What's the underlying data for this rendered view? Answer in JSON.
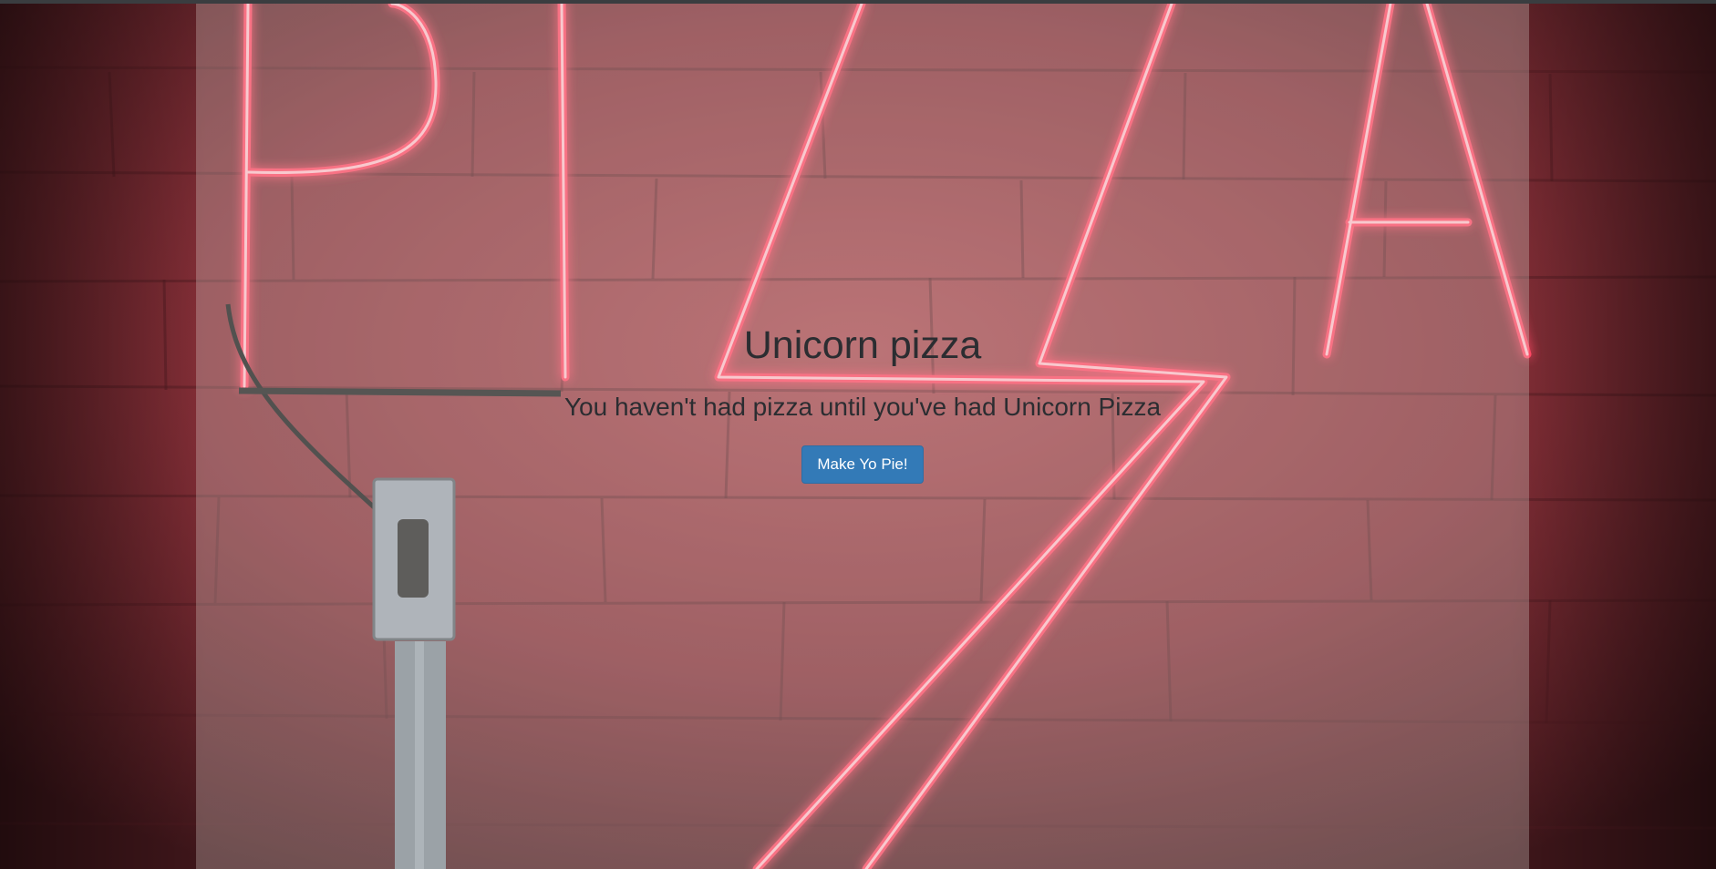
{
  "hero": {
    "title": "Unicorn pizza",
    "tagline": "You haven't had pizza until you've had Unicorn Pizza",
    "cta_label": "Make Yo Pie!"
  },
  "background": {
    "neon_sign_letters": "PIZZA",
    "neon_color": "#ff3b5c",
    "wall_color": "#7a2c34"
  },
  "colors": {
    "panel_tint": "rgba(230,225,220,0.28)",
    "text": "#2b2d31",
    "button_bg": "#337ab7",
    "button_border": "#2e6da4",
    "button_text": "#ffffff"
  }
}
